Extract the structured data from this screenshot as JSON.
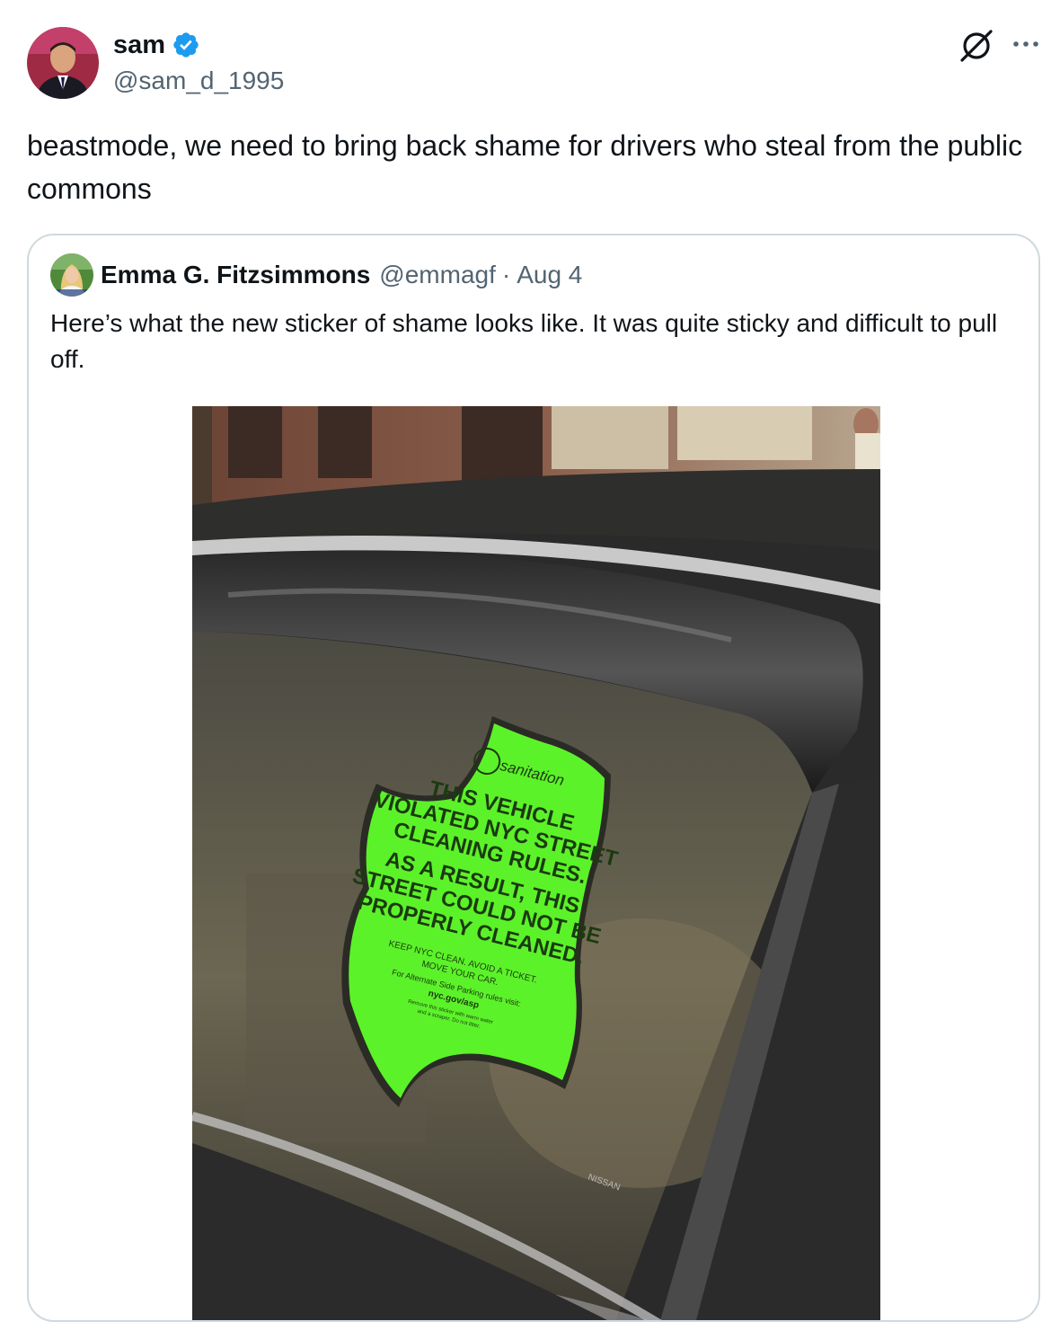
{
  "tweet": {
    "author": {
      "display_name": "sam",
      "handle": "@sam_d_1995",
      "verified": true
    },
    "text": "beastmode, we need to bring back shame for drivers who steal from the public commons",
    "icons": [
      "grok-icon",
      "more-icon",
      "verified-badge-icon"
    ]
  },
  "quoted_tweet": {
    "author": {
      "display_name": "Emma G. Fitzsimmons",
      "handle": "@emmagf"
    },
    "separator": "·",
    "date": "Aug 4",
    "text": "Here’s what the new sticker of shame looks like. It was quite sticky and difficult to pull off.",
    "photo": {
      "sticker": {
        "brand": "sanitation",
        "lines": [
          "THIS VEHICLE",
          "VIOLATED NYC STREET",
          "CLEANING RULES.",
          "AS A RESULT, THIS",
          "STREET COULD NOT BE",
          "PROPERLY CLEANED.",
          "KEEP NYC CLEAN. AVOID A TICKET.",
          "MOVE YOUR CAR.",
          "For Alternate Side Parking rules visit:",
          "nyc.gov/asp",
          "Remove this sticker with warm water",
          "and a scraper. Do not litter."
        ],
        "color": "#5cf22a"
      },
      "window_label": "NISSAN"
    }
  },
  "colors": {
    "text_primary": "#0f1419",
    "text_secondary": "#536471",
    "verified_blue": "#1d9bf0",
    "border": "#cfd9de"
  }
}
